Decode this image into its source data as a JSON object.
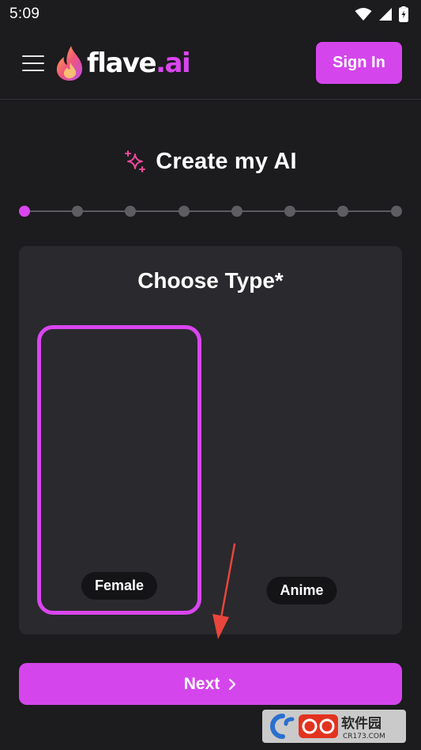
{
  "status_bar": {
    "time": "5:09",
    "icons": [
      "wifi-icon",
      "signal-icon",
      "battery-charging-icon"
    ]
  },
  "header": {
    "menu_icon": "hamburger-menu-icon",
    "logo_text": "flave",
    "logo_tld": ".ai",
    "sign_in_label": "Sign In"
  },
  "page": {
    "title": "Create my AI",
    "title_icon": "sparkles-icon"
  },
  "stepper": {
    "total_steps": 8,
    "current_step": 1
  },
  "type_card": {
    "title": "Choose Type*",
    "options": [
      {
        "label": "Female",
        "selected": true
      },
      {
        "label": "Anime",
        "selected": false
      }
    ]
  },
  "footer": {
    "next_label": "Next",
    "next_icon": "chevron-right-icon"
  },
  "watermark": {
    "chinese": "软件园",
    "domain": "CR173.COM"
  },
  "colors": {
    "background": "#1c1b1e",
    "card": "#2a292d",
    "accent": "#d946ef",
    "button": "#d446ec",
    "inactive_dot": "#5e5d62",
    "annotation": "#e8453c"
  }
}
